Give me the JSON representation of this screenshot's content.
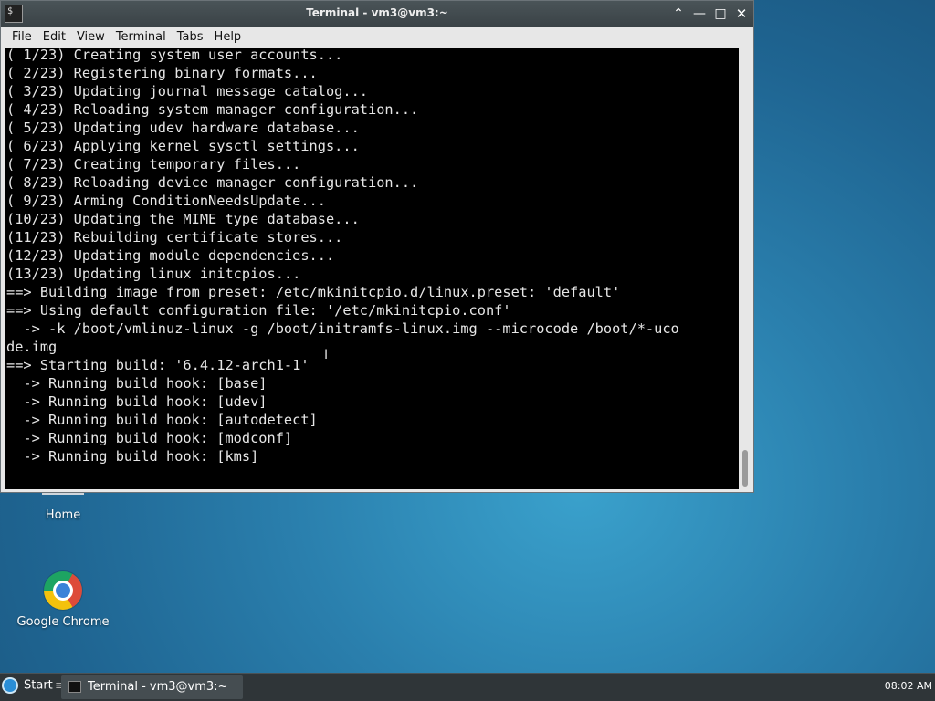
{
  "desktop": {
    "icons": [
      {
        "label": "Home"
      },
      {
        "label": "Google Chrome"
      }
    ]
  },
  "window": {
    "title": "Terminal - vm3@vm3:~",
    "app_icon_glyph": "$_",
    "controls": {
      "shade": "⌃",
      "minimize": "—",
      "maximize": "□",
      "close": "✕"
    }
  },
  "menu": [
    "File",
    "Edit",
    "View",
    "Terminal",
    "Tabs",
    "Help"
  ],
  "terminal": {
    "lines": [
      "( 1/23) Creating system user accounts...",
      "( 2/23) Registering binary formats...",
      "( 3/23) Updating journal message catalog...",
      "( 4/23) Reloading system manager configuration...",
      "( 5/23) Updating udev hardware database...",
      "( 6/23) Applying kernel sysctl settings...",
      "( 7/23) Creating temporary files...",
      "( 8/23) Reloading device manager configuration...",
      "( 9/23) Arming ConditionNeedsUpdate...",
      "(10/23) Updating the MIME type database...",
      "(11/23) Rebuilding certificate stores...",
      "(12/23) Updating module dependencies...",
      "(13/23) Updating linux initcpios...",
      "==> Building image from preset: /etc/mkinitcpio.d/linux.preset: 'default'",
      "==> Using default configuration file: '/etc/mkinitcpio.conf'",
      "  -> -k /boot/vmlinuz-linux -g /boot/initramfs-linux.img --microcode /boot/*-uco",
      "de.img",
      "==> Starting build: '6.4.12-arch1-1'",
      "  -> Running build hook: [base]",
      "  -> Running build hook: [udev]",
      "  -> Running build hook: [autodetect]",
      "  -> Running build hook: [modconf]",
      "  -> Running build hook: [kms]"
    ]
  },
  "taskbar": {
    "start_label": "Start",
    "separator": "≡",
    "task_label": "Terminal - vm3@vm3:~",
    "clock": "08:02 AM"
  }
}
